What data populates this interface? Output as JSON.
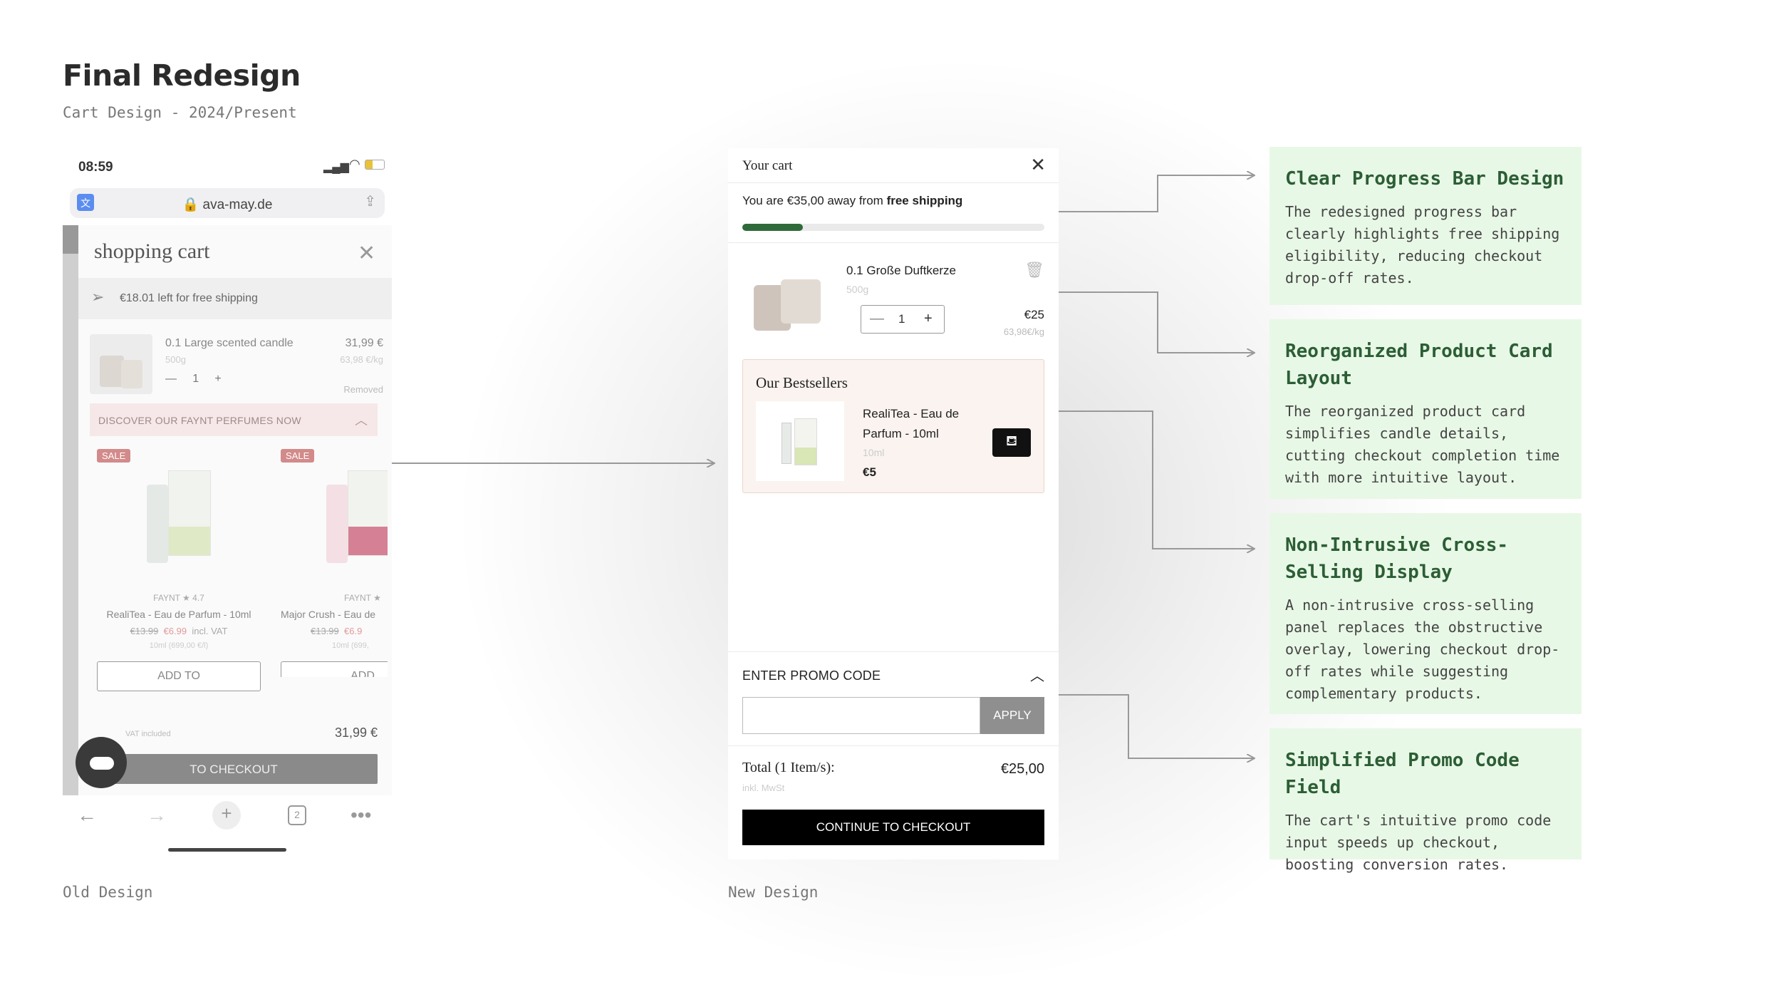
{
  "header": {
    "title": "Final Redesign",
    "subtitle": "Cart Design - 2024/Present"
  },
  "captions": {
    "old": "Old Design",
    "new": "New Design"
  },
  "old_design": {
    "status_time": "08:59",
    "url": "ava-may.de",
    "cart_title": "shopping cart",
    "shipping_text": "€18.01 left for free shipping",
    "product": {
      "name": "0.1 Large scented candle",
      "price": "31,99 €",
      "weight": "500g",
      "price_per_kg": "63,98 €/kg",
      "qty": "1",
      "removed": "Removed"
    },
    "discover_text": "DISCOVER OUR FAYNT PERFUMES NOW",
    "cards": [
      {
        "badge": "SALE",
        "brand": "FAYNT  ★ 4.7",
        "name": "RealiTea - Eau de Parfum - 10ml",
        "old_price": "€13.99",
        "new_price": "€6.99",
        "vat": "incl. VAT",
        "unit": "10ml (699,00 €/l)",
        "button": "ADD TO"
      },
      {
        "badge": "SALE",
        "brand": "FAYNT  ★",
        "name": "Major Crush - Eau de",
        "old_price": "€13.99",
        "new_price": "€6.9",
        "vat": "",
        "unit": "10ml (699,",
        "button": "ADD"
      }
    ],
    "total_vat": "VAT included",
    "total": "31,99 €",
    "checkout": "TO CHECKOUT",
    "tabs_count": "2"
  },
  "new_design": {
    "title": "Your cart",
    "shipping_prefix": "You are €35,00 away from",
    "shipping_bold": "free shipping",
    "progress": 0.2,
    "product": {
      "name": "0.1 Große Duftkerze",
      "weight": "500g",
      "qty": "1",
      "price": "€25",
      "price_per_kg": "63,98€/kg"
    },
    "bestsellers": {
      "heading": "Our Bestsellers",
      "name": "RealiTea - Eau de Parfum - 10ml",
      "size": "10ml",
      "price": "€5"
    },
    "promo_heading": "ENTER PROMO CODE",
    "promo_button": "APPLY",
    "total_label": "Total (1 Item/s):",
    "total_value": "€25,00",
    "total_sub": "inkl. MwSt",
    "checkout": "CONTINUE TO CHECKOUT"
  },
  "notes": [
    {
      "title": "Clear Progress Bar Design",
      "body": "The redesigned progress bar clearly highlights free shipping eligibility, reducing checkout drop-off rates."
    },
    {
      "title": "Reorganized Product Card Layout",
      "body": "The reorganized product card simplifies candle details, cutting checkout completion time with more intuitive layout."
    },
    {
      "title": "Non-Intrusive Cross-Selling Display",
      "body": "A non-intrusive cross-selling panel replaces the obstructive overlay, lowering checkout drop-off rates while suggesting complementary products."
    },
    {
      "title": "Simplified Promo Code Field",
      "body": "The cart's intuitive promo code input speeds up checkout, boosting conversion rates."
    }
  ],
  "colors": {
    "accent_green": "#2f6b3a",
    "note_bg": "#e8f8e6",
    "sale_badge": "#d38a8a"
  }
}
